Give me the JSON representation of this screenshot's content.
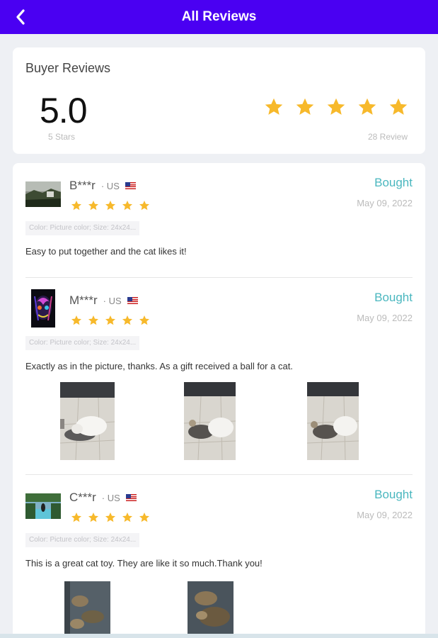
{
  "header": {
    "title": "All Reviews",
    "back_icon": "chevron-left-icon"
  },
  "summary": {
    "heading": "Buyer Reviews",
    "score": "5.0",
    "score_label": "5 Stars",
    "star_rating": 5,
    "review_count_label": "28 Review",
    "star_color": "#f7b92b"
  },
  "reviews": [
    {
      "name": "B***r",
      "country": "· US",
      "rating": 5,
      "status": "Bought",
      "date": "May 09, 2022",
      "variant": "Color: Picture color; Size: 24x24...",
      "text": "Easy to put together and the cat likes it!"
    },
    {
      "name": "M***r",
      "country": "· US",
      "rating": 5,
      "status": "Bought",
      "date": "May 09, 2022",
      "variant": "Color: Picture color; Size: 24x24...",
      "text": "Exactly as in the picture, thanks. As a gift received a ball for a cat."
    },
    {
      "name": "C***r",
      "country": "· US",
      "rating": 5,
      "status": "Bought",
      "date": "May 09, 2022",
      "variant": "Color: Picture color; Size: 24x24...",
      "text": "This is a great cat toy. They are like it so much.Thank you!"
    }
  ],
  "colors": {
    "accent": "#4a00f2",
    "bought": "#4ab7bf"
  }
}
